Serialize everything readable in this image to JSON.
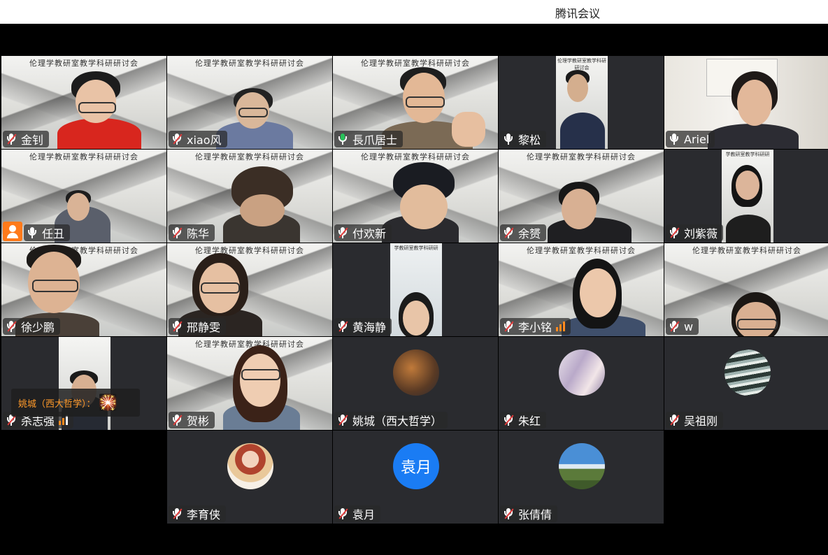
{
  "app": {
    "title": "腾讯会议"
  },
  "banner_text": "伦理学教研室教学科研研讨会",
  "banner_text_short": "学教研室教学科研研",
  "participants": [
    {
      "name": "金钊",
      "mic": "muted"
    },
    {
      "name": "xiao风",
      "mic": "muted"
    },
    {
      "name": "長爪居士",
      "mic": "speaking"
    },
    {
      "name": "黎松",
      "mic": "on"
    },
    {
      "name": "Ariel",
      "mic": "on"
    },
    {
      "name": "任丑",
      "mic": "on",
      "role": "host"
    },
    {
      "name": "陈华",
      "mic": "muted"
    },
    {
      "name": "付欢新",
      "mic": "muted"
    },
    {
      "name": "余赟",
      "mic": "muted"
    },
    {
      "name": "刘紫薇",
      "mic": "muted"
    },
    {
      "name": "徐少鹏",
      "mic": "muted"
    },
    {
      "name": "邢静雯",
      "mic": "muted"
    },
    {
      "name": "黄海静",
      "mic": "muted"
    },
    {
      "name": "李小铭",
      "mic": "muted",
      "volume": 3
    },
    {
      "name": "w",
      "mic": "muted"
    },
    {
      "name": "杀志强",
      "mic": "muted",
      "volume": 2
    },
    {
      "name": "贺彬",
      "mic": "muted"
    },
    {
      "name": "姚城（西大哲学）",
      "mic": "muted"
    },
    {
      "name": "朱红",
      "mic": "muted"
    },
    {
      "name": "吴祖刚",
      "mic": "muted"
    },
    {
      "name": "李育侠",
      "mic": "muted"
    },
    {
      "name": "袁月",
      "mic": "muted",
      "avatar_text": "袁月"
    },
    {
      "name": "张倩倩",
      "mic": "muted"
    }
  ],
  "chat_popup": {
    "sender": "姚城（西大哲学）：",
    "emoji": "🎇"
  },
  "colors": {
    "speaking": "#27c25a",
    "muted_slash": "#e03b3b",
    "host_badge": "#ff7a1a",
    "avatar_blue": "#1a7cf4"
  }
}
